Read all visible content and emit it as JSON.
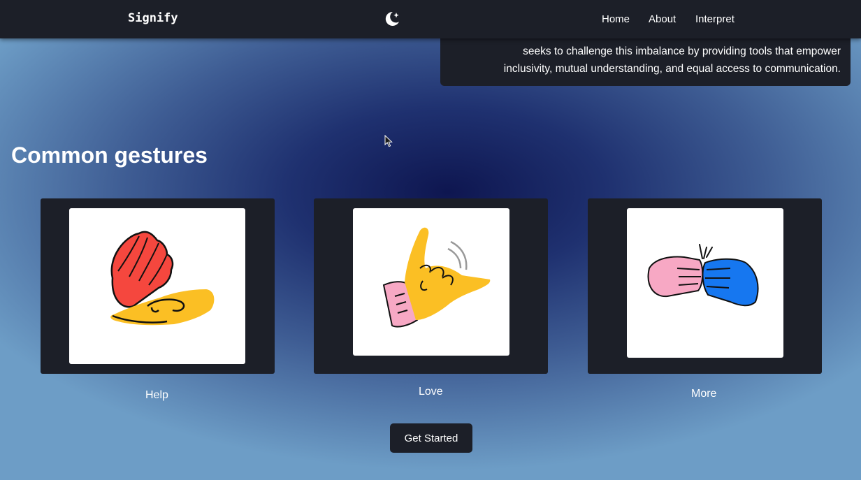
{
  "nav": {
    "brand": "Signify",
    "theme_icon": "moon-sparkle-icon",
    "links": [
      "Home",
      "About",
      "Interpret"
    ]
  },
  "about": {
    "lines": [
      "seeks to challenge this imbalance by providing tools that empower",
      "inclusivity, mutual understanding, and equal access to communication."
    ]
  },
  "gestures": {
    "title": "Common gestures",
    "cards": [
      {
        "label": "Help",
        "icon": "help-sign-icon"
      },
      {
        "label": "Love",
        "icon": "love-sign-icon"
      },
      {
        "label": "More",
        "icon": "more-sign-icon"
      }
    ]
  },
  "cta": {
    "label": "Get Started"
  },
  "colors": {
    "nav_bg": "#1c1f28",
    "card_bg": "#1c1f28",
    "bg_center": "#0e1650",
    "bg_edge": "#6d9dc6",
    "red": "#f5473e",
    "yellow": "#fbbf24",
    "pink": "#f7a8c4",
    "blue": "#1677f0"
  }
}
